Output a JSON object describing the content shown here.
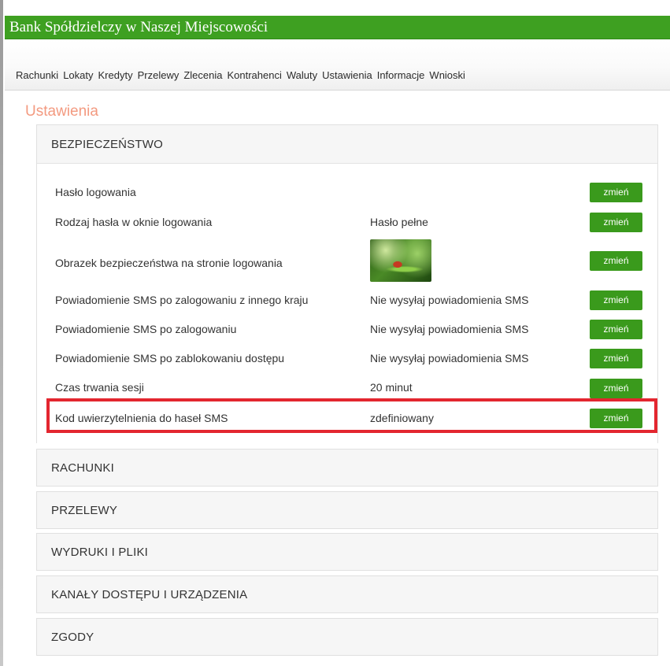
{
  "header": {
    "title": "Bank Spółdzielczy w Naszej Miejscowości"
  },
  "nav": {
    "items": [
      "Rachunki",
      "Lokaty",
      "Kredyty",
      "Przelewy",
      "Zlecenia",
      "Kontrahenci",
      "Waluty",
      "Ustawienia",
      "Informacje",
      "Wnioski"
    ]
  },
  "page": {
    "title": "Ustawienia"
  },
  "security": {
    "title": "BEZPIECZEŃSTWO",
    "button_label": "zmień",
    "rows": [
      {
        "label": "Hasło logowania",
        "value": ""
      },
      {
        "label": "Rodzaj hasła w oknie logowania",
        "value": "Hasło pełne"
      },
      {
        "label": "Obrazek bezpieczeństwa na stronie logowania",
        "value": ""
      },
      {
        "label": "Powiadomienie SMS po zalogowaniu z innego kraju",
        "value": "Nie wysyłaj powiadomienia SMS"
      },
      {
        "label": "Powiadomienie SMS po zalogowaniu",
        "value": "Nie wysyłaj powiadomienia SMS"
      },
      {
        "label": "Powiadomienie SMS po zablokowaniu dostępu",
        "value": "Nie wysyłaj powiadomienia SMS"
      },
      {
        "label": "Czas trwania sesji",
        "value": "20 minut"
      },
      {
        "label": "Kod uwierzytelnienia do haseł SMS",
        "value": "zdefiniowany"
      }
    ]
  },
  "sections": [
    "RACHUNKI",
    "PRZELEWY",
    "WYDRUKI I PLIKI",
    "KANAŁY DOSTĘPU I URZĄDZENIA",
    "ZGODY"
  ],
  "colors": {
    "header_green": "#3ea021",
    "button_green": "#3a9a1c",
    "title_salmon": "#f39a80",
    "highlight_red": "#e3262f"
  }
}
